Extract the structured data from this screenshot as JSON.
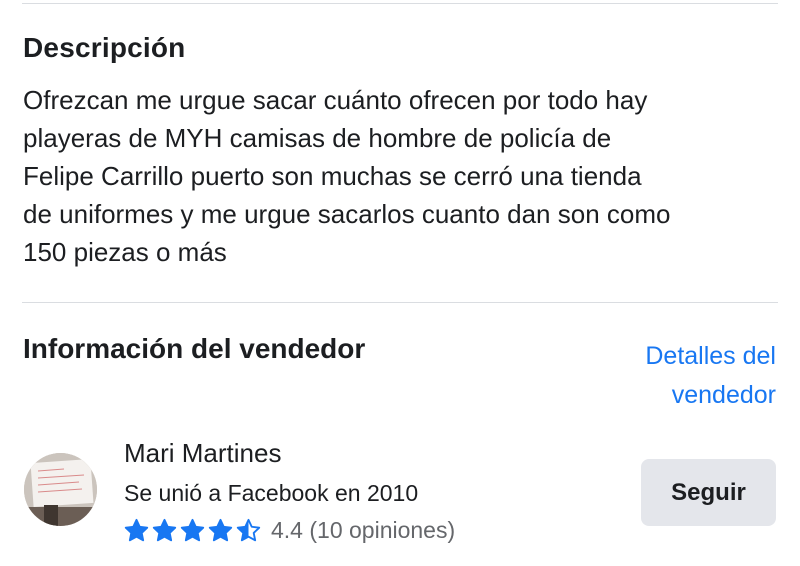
{
  "description": {
    "title": "Descripción",
    "text": "Ofrezcan me urgue sacar  cuánto ofrecen por todo hay\nplayeras de MYH camisas de hombre de policía de\nFelipe Carrillo puerto  son muchas se cerró una tienda\nde uniformes y me urgue sacarlos cuanto dan son como\n150 piezas o más"
  },
  "seller_section": {
    "title": "Información del vendedor",
    "details_link": "Detalles del vendedor"
  },
  "seller": {
    "name": "Mari Martines",
    "joined": "Se unió a Facebook en 2010",
    "rating": 4.4,
    "rating_max": 5,
    "rating_label": "4.4 (10 opiniones)",
    "follow_label": "Seguir"
  },
  "colors": {
    "accent": "#1877f2",
    "text": "#1c1e21",
    "secondary_text": "#65676b",
    "button_bg": "#e4e6eb",
    "divider": "#dadde1"
  }
}
